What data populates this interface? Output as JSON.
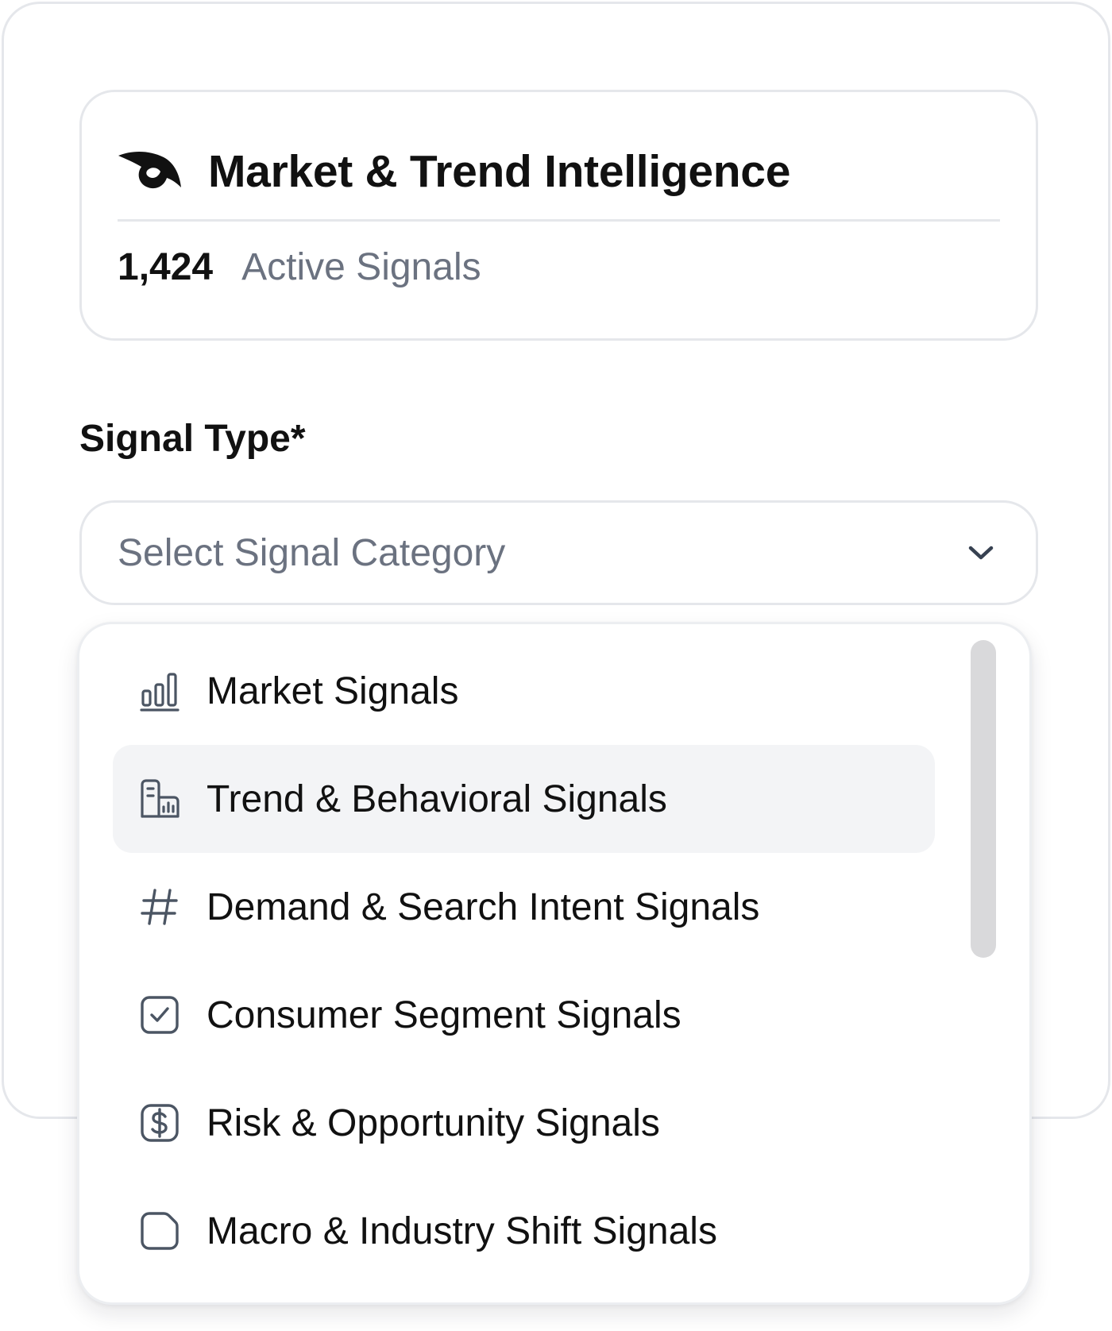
{
  "card": {
    "title": "Market & Trend Intelligence",
    "active_count": "1,424",
    "active_label": "Active Signals"
  },
  "field": {
    "label": "Signal Type*",
    "placeholder": "Select Signal Category"
  },
  "dropdown": {
    "options": [
      {
        "label": "Market Signals",
        "icon": "bar-chart-icon"
      },
      {
        "label": "Trend & Behavioral Signals",
        "icon": "building-chart-icon"
      },
      {
        "label": "Demand & Search Intent Signals",
        "icon": "hashtag-icon"
      },
      {
        "label": "Consumer Segment Signals",
        "icon": "checkbox-icon"
      },
      {
        "label": "Risk & Opportunity Signals",
        "icon": "dollar-icon"
      },
      {
        "label": "Macro & Industry Shift Signals",
        "icon": "folded-page-icon"
      }
    ],
    "hovered_option": "Trend & Behavioral Signals"
  },
  "colors": {
    "text": "#111111",
    "muted": "#6b7280",
    "border": "#e5e7eb",
    "hover": "#f3f4f6",
    "scrollbar": "#d9d9db",
    "icon": "#4b5563"
  }
}
